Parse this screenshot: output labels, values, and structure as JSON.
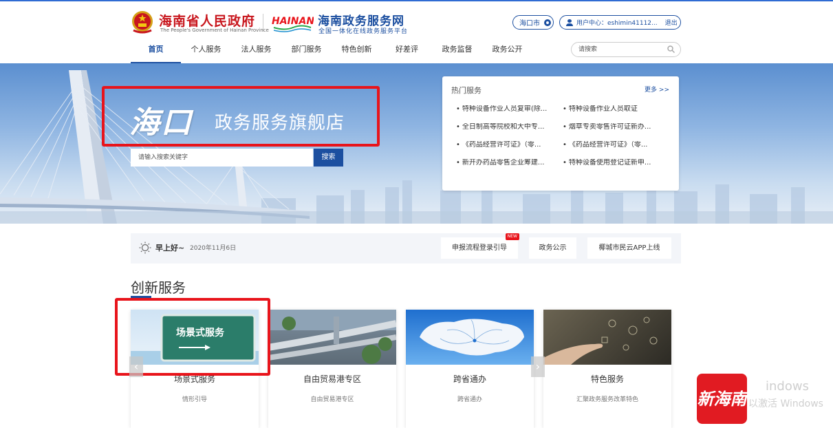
{
  "header": {
    "gov_name": "海南省人民政府",
    "gov_en": "The People's Government of Hainan Province",
    "hainan_logo": "HAINAN",
    "site_name": "海南政务服务网",
    "site_sub": "全国一体化在线政务服务平台",
    "city": "海口市",
    "user_label": "用户中心：eshimin41112...",
    "logout": "退出",
    "search_placeholder": "请搜索"
  },
  "nav": [
    {
      "label": "首页",
      "active": true
    },
    {
      "label": "个人服务"
    },
    {
      "label": "法人服务"
    },
    {
      "label": "部门服务"
    },
    {
      "label": "特色创新"
    },
    {
      "label": "好差评"
    },
    {
      "label": "政务监督"
    },
    {
      "label": "政务公开"
    }
  ],
  "banner": {
    "brand_big": "海口",
    "brand_small": "政务服务旗舰店",
    "search_placeholder": "请输入搜索关键字",
    "search_button": "搜索"
  },
  "hot": {
    "title": "热门服务",
    "more": "更多 >>",
    "items": [
      "特种设备作业人员复审(除...",
      "特种设备作业人员取证",
      "全日制高等院校和大中专...",
      "烟草专卖零售许可证新办...",
      "《药品经营许可证》（零...",
      "《药品经营许可证》（零...",
      "新开办药品零售企业筹建...",
      "特种设备使用登记证新申..."
    ]
  },
  "infobar": {
    "greeting": "早上好~",
    "date": "2020年11月6日",
    "links": [
      {
        "label": "申报流程登录引导",
        "badge": "NEW"
      },
      {
        "label": "政务公示"
      },
      {
        "label": "椰城市民云APP上线"
      }
    ]
  },
  "section": {
    "title": "创新服务",
    "cards": [
      {
        "title": "场景式服务",
        "sub": "情形引导",
        "sign": "场景式服务"
      },
      {
        "title": "自由贸易港专区",
        "sub": "自由贸易港专区"
      },
      {
        "title": "跨省通办",
        "sub": "跨省通办"
      },
      {
        "title": "特色服务",
        "sub": "汇聚政务服务改革特色"
      }
    ]
  },
  "watermark": {
    "line1": "indows",
    "line2": "以激活 Windows",
    "logo": "新海南"
  },
  "colors": {
    "primary": "#1c4fa0",
    "highlight_red": "#e8141b",
    "gov_red": "#c8161d"
  }
}
